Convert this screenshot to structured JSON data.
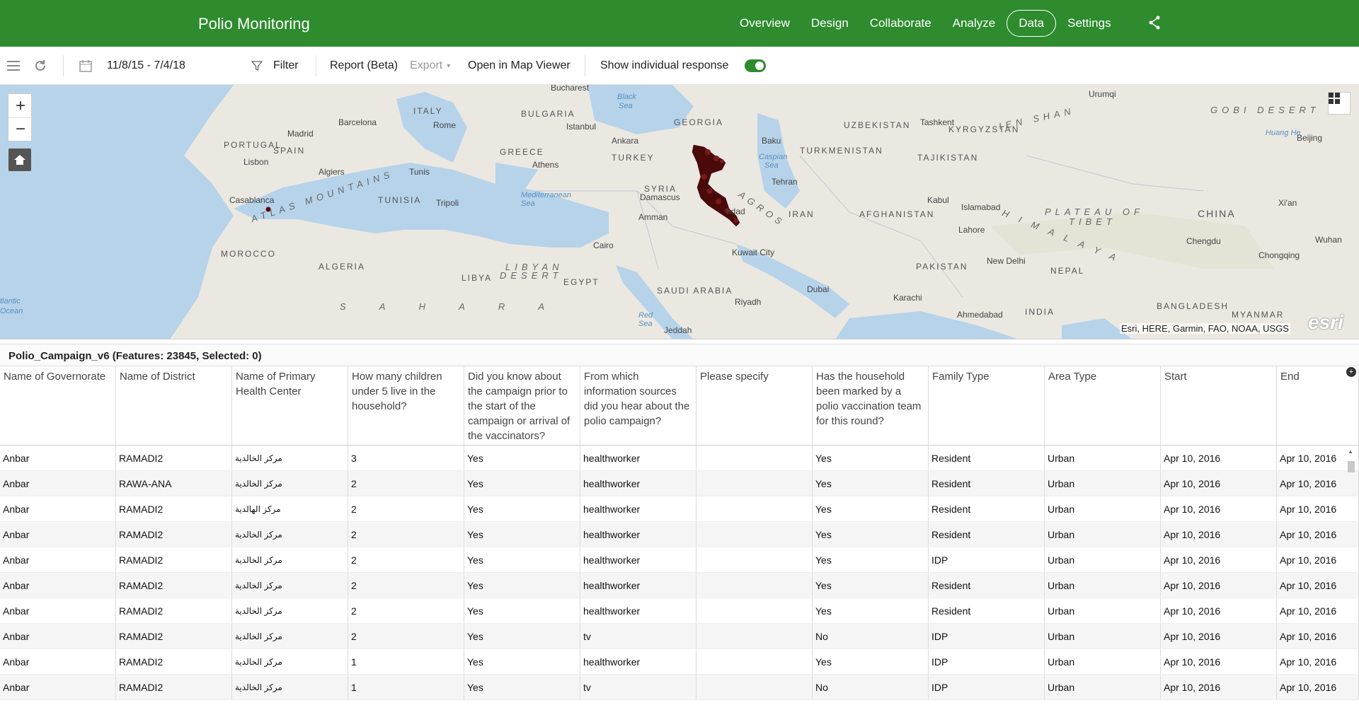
{
  "header": {
    "title": "Polio Monitoring",
    "nav": [
      "Overview",
      "Design",
      "Collaborate",
      "Analyze",
      "Data",
      "Settings"
    ],
    "active_tab": "Data"
  },
  "toolbar": {
    "date_range": "11/8/15 - 7/4/18",
    "filter_label": "Filter",
    "report_label": "Report (Beta)",
    "export_label": "Export",
    "open_map_label": "Open in Map Viewer",
    "show_individual_label": "Show individual response",
    "show_individual_on": true
  },
  "map": {
    "labels": {
      "bucharest": "Bucharest",
      "black_sea": "Black",
      "black_sea2": "Sea",
      "georgia": "GEORGIA",
      "bulgaria": "BULGARIA",
      "italy": "ITALY",
      "barcelona": "Barcelona",
      "rome": "Rome",
      "istanbul": "Istanbul",
      "ankara": "Ankara",
      "baku": "Baku",
      "madrid": "Madrid",
      "portugal": "PORTUGAL",
      "spain": "SPAIN",
      "lisbon": "Lisbon",
      "greece": "GREECE",
      "athens": "Athens",
      "turkey": "TURKEY",
      "caspian": "Caspian",
      "caspian2": "Sea",
      "algiers": "Algiers",
      "tunis": "Tunis",
      "tehran": "Tehran",
      "atlas": "ATLAS MOUNTAINS",
      "tunisia": "TUNISIA",
      "casablanca": "Casablanca",
      "tripoli": "Tripoli",
      "syria": "SYRIA",
      "damascus": "Damascus",
      "medsea": "Mediterranean",
      "medsea2": "Sea",
      "amman": "Amman",
      "baghdad": "hdad",
      "zagros": "AGROS",
      "iran": "IRAN",
      "morocco": "MOROCCO",
      "cairo": "Cairo",
      "kuwait": "Kuwait City",
      "algeria": "ALGERIA",
      "libyan_desert": "LIBYAN",
      "libyan_desert2": "DESERT",
      "libya": "LIBYA",
      "egypt": "EGYPT",
      "saudi": "SAUDI ARABIA",
      "riyadh": "Riyadh",
      "dubai": "Dubai",
      "sahara": "S A H A R A",
      "atlantic": "tlantic",
      "ocean": "Ocean",
      "red_sea": "Red",
      "red_sea2": "Sea",
      "jeddah": "Jeddah",
      "uzbekistan": "UZBEKISTAN",
      "turkmenistan": "TURKMENISTAN",
      "tashkent": "Tashkent",
      "kyrgyzstan": "KYRGYZSTAN",
      "tajikistan": "TAJIKISTAN",
      "tien_shan": "IEN SHAN",
      "gobi": "GOBI DESERT",
      "urumqi": "Urumqi",
      "beijing": "Beijing",
      "afghanistan": "AFGHANISTAN",
      "kabul": "Kabul",
      "islamabad": "Islamabad",
      "lahore": "Lahore",
      "plateau": "PLATEAU OF",
      "tibet": "TIBET",
      "china": "CHINA",
      "xian": "Xi'an",
      "himalaya": "H I M A L A Y A",
      "pakistan": "PAKISTAN",
      "new_delhi": "New Delhi",
      "nepal": "NEPAL",
      "chengdu": "Chengdu",
      "chongqing": "Chongqing",
      "wuhan": "Wuhan",
      "karachi": "Karachi",
      "ahmedabad": "Ahmedabad",
      "india": "INDIA",
      "bangladesh": "BANGLADESH",
      "myanmar": "MYANMAR",
      "huang_he": "Huang He"
    },
    "attribution": "Esri, HERE, Garmin, FAO, NOAA, USGS",
    "logo": "esri"
  },
  "table": {
    "title": "Polio_Campaign_v6 (Features: 23845, Selected: 0)",
    "columns": [
      "Name of Governorate",
      "Name of District",
      "Name of Primary Health Center",
      "How many children under 5 live in the household?",
      "Did you know about the campaign prior to the start of the campaign or arrival of the vaccinators?",
      "From which information sources did you hear about the polio campaign?",
      "Please specify",
      "Has the household been marked by a polio vaccination team for this round?",
      "Family Type",
      "Area Type",
      "Start",
      "End"
    ],
    "rows": [
      [
        "Anbar",
        "RAMADI2",
        "مركز الخالدية",
        "3",
        "Yes",
        "healthworker",
        "",
        "Yes",
        "Resident",
        "Urban",
        "Apr 10, 2016",
        "Apr 10, 2016"
      ],
      [
        "Anbar",
        "RAWA-ANA",
        "مركز الخالدية",
        "2",
        "Yes",
        "healthworker",
        "",
        "Yes",
        "Resident",
        "Urban",
        "Apr 10, 2016",
        "Apr 10, 2016"
      ],
      [
        "Anbar",
        "RAMADI2",
        "مركز الهالدية",
        "2",
        "Yes",
        "healthworker",
        "",
        "Yes",
        "Resident",
        "Urban",
        "Apr 10, 2016",
        "Apr 10, 2016"
      ],
      [
        "Anbar",
        "RAMADI2",
        "مركز الخالدية",
        "2",
        "Yes",
        "healthworker",
        "",
        "Yes",
        "Resident",
        "Urban",
        "Apr 10, 2016",
        "Apr 10, 2016"
      ],
      [
        "Anbar",
        "RAMADI2",
        "مركز الخالدية",
        "2",
        "Yes",
        "healthworker",
        "",
        "Yes",
        "IDP",
        "Urban",
        "Apr 10, 2016",
        "Apr 10, 2016"
      ],
      [
        "Anbar",
        "RAMADI2",
        "مركز الخالدية",
        "2",
        "Yes",
        "healthworker",
        "",
        "Yes",
        "Resident",
        "Urban",
        "Apr 10, 2016",
        "Apr 10, 2016"
      ],
      [
        "Anbar",
        "RAMADI2",
        "مركز الخالدية",
        "2",
        "Yes",
        "healthworker",
        "",
        "Yes",
        "Resident",
        "Urban",
        "Apr 10, 2016",
        "Apr 10, 2016"
      ],
      [
        "Anbar",
        "RAMADI2",
        "مركز الخالدية",
        "2",
        "Yes",
        "tv",
        "",
        "No",
        "IDP",
        "Urban",
        "Apr 10, 2016",
        "Apr 10, 2016"
      ],
      [
        "Anbar",
        "RAMADI2",
        "مركز الخالدية",
        "1",
        "Yes",
        "healthworker",
        "",
        "Yes",
        "IDP",
        "Urban",
        "Apr 10, 2016",
        "Apr 10, 2016"
      ],
      [
        "Anbar",
        "RAMADI2",
        "مركز الخالدية",
        "1",
        "Yes",
        "tv",
        "",
        "No",
        "IDP",
        "Urban",
        "Apr 10, 2016",
        "Apr 10, 2016"
      ]
    ]
  },
  "colors": {
    "brand": "#2e8b2e",
    "water": "#b6d3ea",
    "land": "#eae8e1",
    "point": "#5a0d0d"
  }
}
